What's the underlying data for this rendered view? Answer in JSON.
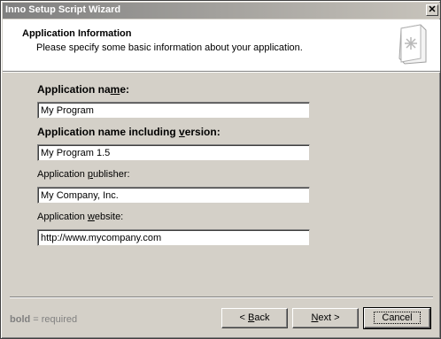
{
  "window": {
    "title": "Inno Setup Script Wizard",
    "close_glyph": "✕"
  },
  "header": {
    "title": "Application Information",
    "subtitle": "Please specify some basic information about your application.",
    "icon": "wizard-book-icon"
  },
  "fields": [
    {
      "label_pre": "Application na",
      "label_u": "m",
      "label_post": "e:",
      "value": "My Program",
      "required": true
    },
    {
      "label_pre": "Application name including ",
      "label_u": "v",
      "label_post": "ersion:",
      "value": "My Program 1.5",
      "required": true
    },
    {
      "label_pre": "Application ",
      "label_u": "p",
      "label_post": "ublisher:",
      "value": "My Company, Inc.",
      "required": false
    },
    {
      "label_pre": "Application ",
      "label_u": "w",
      "label_post": "ebsite:",
      "value": "http://www.mycompany.com",
      "required": false
    }
  ],
  "footer": {
    "note_bold": "bold",
    "note_rest": " = required",
    "back_pre": "< ",
    "back_u": "B",
    "back_post": "ack",
    "next_u": "N",
    "next_post": "ext >",
    "cancel": "Cancel"
  }
}
